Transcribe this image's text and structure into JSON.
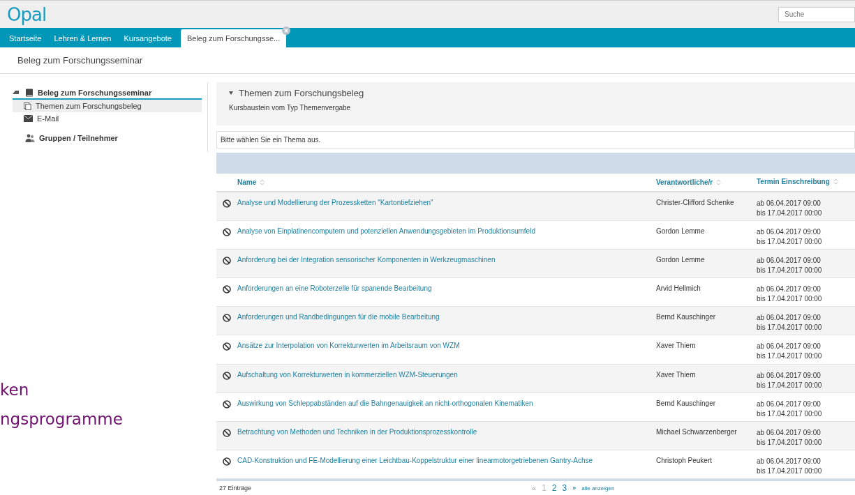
{
  "header": {
    "logo": "Opal",
    "search": {
      "placeholder": "Suche"
    }
  },
  "tabs": [
    {
      "label": "Startseite",
      "selected": false,
      "closable": false
    },
    {
      "label": "Lehren & Lernen",
      "selected": false,
      "closable": false
    },
    {
      "label": "Kursangebote",
      "selected": false,
      "closable": false
    },
    {
      "label": "Beleg zum Forschungsse...",
      "selected": true,
      "closable": true
    }
  ],
  "page_title": "Beleg zum Forschungsseminar",
  "sidebar": {
    "tree": [
      {
        "label": "Beleg zum Forschungsseminar",
        "kind": "book",
        "expanded": true,
        "selected": false,
        "children": [
          {
            "label": "Themen zum Forschungsbeleg",
            "kind": "pages",
            "selected": true
          },
          {
            "label": "E-Mail",
            "kind": "mail",
            "selected": false
          }
        ]
      },
      {
        "label": "Gruppen / Teilnehmer",
        "kind": "people",
        "expanded": false,
        "selected": false
      }
    ]
  },
  "node": {
    "title": "Themen zum Forschungsbeleg",
    "expanded": true,
    "subtitle": "Kursbaustein vom Typ Themenvergabe"
  },
  "notice": "Bitte wählen Sie ein Thema aus.",
  "table": {
    "columns": [
      "Name",
      "Verantwortliche/r",
      "Termin Einschreibung"
    ],
    "rows": [
      {
        "name": "Analyse und Modellierung der Prozessketten \"Kartontiefziehen\"",
        "person": "Christer-Clifford Schenke",
        "from": "ab 06.04.2017 09:00",
        "to": "bis 17.04.2017 00:00"
      },
      {
        "name": "Analyse von Einplatinencomputern und potenziellen Anwendungsgebieten im Produktionsumfeld",
        "person": "Gordon Lemme",
        "from": "ab 06.04.2017 09:00",
        "to": "bis 17.04.2017 00:00"
      },
      {
        "name": "Anforderung bei der Integration sensorischer Komponenten in Werkzeugmaschinen",
        "person": "Gordon Lemme",
        "from": "ab 06.04.2017 09:00",
        "to": "bis 17.04.2017 00:00"
      },
      {
        "name": "Anforderungen an eine Roboterzelle für spanende Bearbeitung",
        "person": "Arvid Hellmich",
        "from": "ab 06.04.2017 09:00",
        "to": "bis 17.04.2017 00:00"
      },
      {
        "name": "Anforderungen und Randbedingungen für die mobile Bearbeitung",
        "person": "Bernd Kauschinger",
        "from": "ab 06.04.2017 09:00",
        "to": "bis 17.04.2017 00:00"
      },
      {
        "name": "Ansätze zur Interpolation von Korrekturwerten im Arbeitsraum von WZM",
        "person": "Xaver Thiem",
        "from": "ab 06.04.2017 09:00",
        "to": "bis 17.04.2017 00:00"
      },
      {
        "name": "Aufschaltung von Korrekturwerten in kommerziellen WZM-Steuerungen",
        "person": "Xaver Thiem",
        "from": "ab 06.04.2017 09:00",
        "to": "bis 17.04.2017 00:00"
      },
      {
        "name": "Auswirkung von Schleppabständen auf die Bahngenauigkeit an nicht-orthogonalen Kinematiken",
        "person": "Bernd Kauschinger",
        "from": "ab 06.04.2017 09:00",
        "to": "bis 17.04.2017 00:00"
      },
      {
        "name": "Betrachtung von Methoden und Techniken in der Produktionsprozesskontrolle",
        "person": "Michael Schwarzenberger",
        "from": "ab 06.04.2017 09:00",
        "to": "bis 17.04.2017 00:00"
      },
      {
        "name": "CAD-Konstruktion und FE-Modellierung einer Leichtbau-Koppelstruktur einer linearmotorgetriebenen Gantry-Achse",
        "person": "Christoph Peukert",
        "from": "ab 06.04.2017 09:00",
        "to": "bis 17.04.2017 00:00"
      }
    ]
  },
  "footer": {
    "count": "27 Einträge",
    "prev": {
      "label": "«",
      "disabled": true
    },
    "pages": [
      {
        "label": "1",
        "selected": true
      },
      {
        "label": "2",
        "selected": false
      },
      {
        "label": "3",
        "selected": false
      }
    ],
    "next": {
      "label": "»",
      "disabled": false
    },
    "show_all": "alle anzeigen"
  },
  "overlay_texts": [
    "ken",
    "ngsprogramme"
  ]
}
